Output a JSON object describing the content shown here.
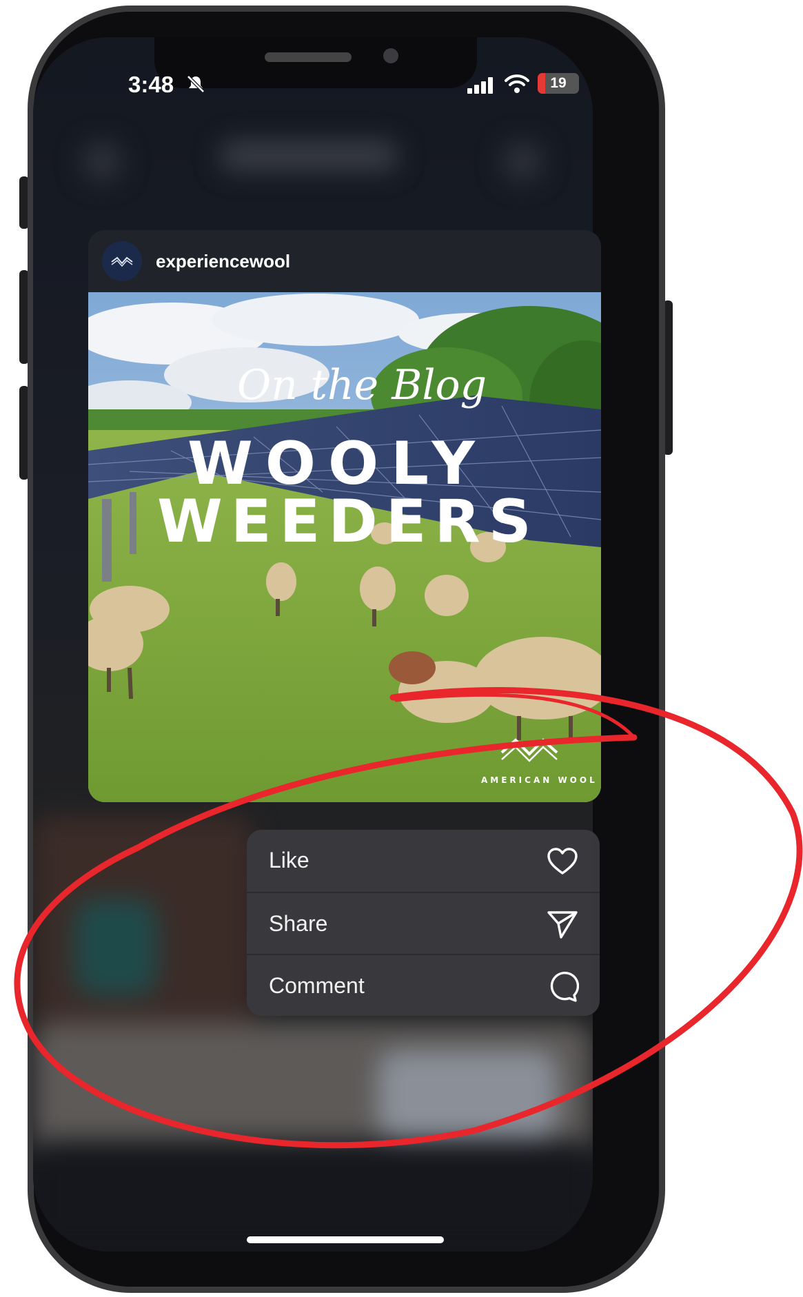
{
  "status_bar": {
    "time": "3:48",
    "battery": "19",
    "battery_level": 0.19,
    "icons": [
      "bell-slash-icon",
      "signal-icon",
      "wifi-icon",
      "battery-icon"
    ]
  },
  "post": {
    "username": "experiencewool",
    "image": {
      "script_text": "On the Blog",
      "headline_line1": "WOOLY",
      "headline_line2": "WEEDERS",
      "brand": "AMERICAN WOOL"
    }
  },
  "context_menu": {
    "items": [
      {
        "label": "Like",
        "icon": "heart-icon"
      },
      {
        "label": "Share",
        "icon": "paper-plane-icon"
      },
      {
        "label": "Comment",
        "icon": "comment-bubble-icon"
      }
    ]
  },
  "colors": {
    "annotation_red": "#e8262b",
    "menu_bg": "#3a3a3e",
    "battery_low": "#e53935"
  }
}
